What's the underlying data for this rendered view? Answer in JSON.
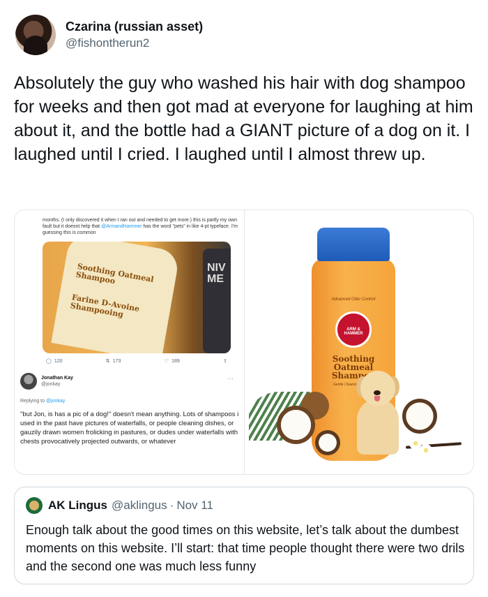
{
  "tweet": {
    "display_name": "Czarina (russian asset)",
    "handle": "@fishontherun2",
    "text": "Absolutely the guy who washed his hair with dog shampoo for weeks and then got mad at everyone for laughing at him about it, and the bottle had a GIANT picture of a dog on it. I laughed until I cried. I laughed until I almost threw up."
  },
  "media": {
    "screenshot": {
      "text_part1": "months. (I only discovered it when I ran out and needed to get more.) this is partly my own fault but it doesnt help that ",
      "text_link": "@ArmandHammer",
      "text_part2": " has the word \"pets\" in like 4-pt typeface. I'm guessing this is common",
      "bottle_label_1": "Soothing Oatmeal Shampoo",
      "bottle_label_2": "Farine D-Avoine Shampooing",
      "other_bottle": "NIV ME",
      "stats": {
        "replies": "120",
        "retweets": "173",
        "likes": "189"
      },
      "reply_name": "Jonathan Kay",
      "reply_handle": "@jonkay",
      "replying_prefix": "Replying to ",
      "replying_link": "@jonkay",
      "reply_body": "\"but Jon, is has a pic of a dog!\" doesn't mean anything. Lots of shampoos i used in the past have pictures of waterfalls, or people cleaning dishes, or gauzily drawn women frolicking in pastures, or dudes under waterfalls with chests provocatively projected outwards, or whatever"
    },
    "product": {
      "top_text": "Advanced Odor Control",
      "badge": "ARM & HAMMER",
      "title": "Soothing Oatmeal Shampoo",
      "subtitle": "Gentle Cleansing Formula"
    }
  },
  "quote": {
    "name": "AK Lingus",
    "handle": "@aklingus",
    "dot": "·",
    "date": "Nov 11",
    "text": "Enough talk about the good times on this website, let’s talk about the dumbest moments on this website. I’ll start: that time people thought there were two drils and the second one was much less funny"
  }
}
